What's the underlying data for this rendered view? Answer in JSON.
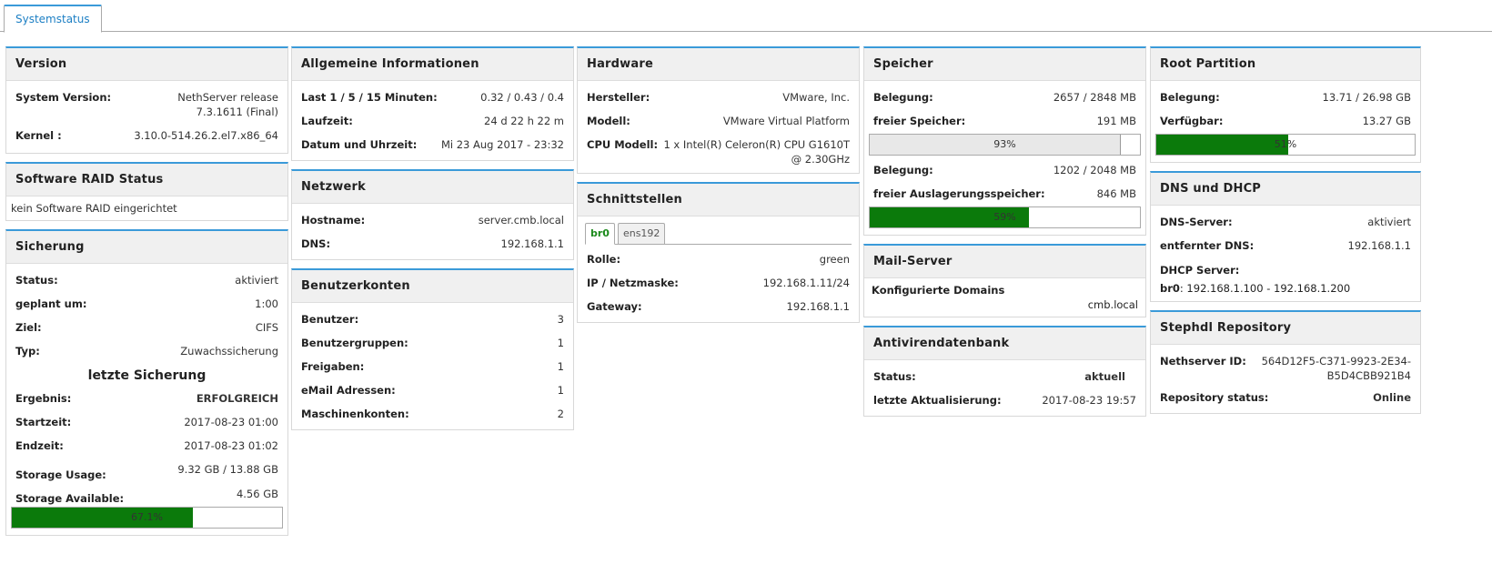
{
  "tab": {
    "label": "Systemstatus"
  },
  "version": {
    "title": "Version",
    "system_version_label": "System Version:",
    "system_version_value": "NethServer release 7.3.1611 (Final)",
    "kernel_label": "Kernel :",
    "kernel_value": "3.10.0-514.26.2.el7.x86_64"
  },
  "raid": {
    "title": "Software RAID Status",
    "text": "kein Software RAID eingerichtet"
  },
  "backup": {
    "title": "Sicherung",
    "status_label": "Status:",
    "status_value": "aktiviert",
    "planned_label": "geplant um:",
    "planned_value": "1:00",
    "target_label": "Ziel:",
    "target_value": "CIFS",
    "type_label": "Typ:",
    "type_value": "Zuwachssicherung",
    "last_title": "letzte Sicherung",
    "result_label": "Ergebnis:",
    "result_value": "ERFOLGREICH",
    "start_label": "Startzeit:",
    "start_value": "2017-08-23 01:00",
    "end_label": "Endzeit:",
    "end_value": "2017-08-23 01:02",
    "usage_label": "Storage Usage:",
    "usage_value": "9.32 GB / 13.88 GB",
    "avail_label": "Storage Available:",
    "avail_value": "4.56 GB",
    "progress_label": "67.1%",
    "progress": 0.671
  },
  "general": {
    "title": "Allgemeine Informationen",
    "load_label": "Last 1 / 5 / 15 Minuten:",
    "load_value": "0.32 / 0.43 / 0.4",
    "uptime_label": "Laufzeit:",
    "uptime_value": "24 d 22 h 22 m",
    "date_label": "Datum und Uhrzeit:",
    "date_value": "Mi 23 Aug 2017 - 23:32"
  },
  "network": {
    "title": "Netzwerk",
    "hostname_label": "Hostname:",
    "hostname_value": "server.cmb.local",
    "dns_label": "DNS:",
    "dns_value": "192.168.1.1"
  },
  "accounts": {
    "title": "Benutzerkonten",
    "users_label": "Benutzer:",
    "users_value": "3",
    "groups_label": "Benutzergruppen:",
    "groups_value": "1",
    "shares_label": "Freigaben:",
    "shares_value": "1",
    "email_label": "eMail Adressen:",
    "email_value": "1",
    "machines_label": "Maschinenkonten:",
    "machines_value": "2"
  },
  "hardware": {
    "title": "Hardware",
    "vendor_label": "Hersteller:",
    "vendor_value": "VMware, Inc.",
    "model_label": "Modell:",
    "model_value": "VMware Virtual Platform",
    "cpu_label": "CPU Modell:",
    "cpu_value": "1 x Intel(R) Celeron(R) CPU G1610T @ 2.30GHz"
  },
  "interfaces": {
    "title": "Schnittstellen",
    "tabs": [
      "br0",
      "ens192"
    ],
    "role_label": "Rolle:",
    "role_value": "green",
    "ip_label": "IP / Netzmaske:",
    "ip_value": "192.168.1.11/24",
    "gw_label": "Gateway:",
    "gw_value": "192.168.1.1"
  },
  "memory": {
    "title": "Speicher",
    "used_label": "Belegung:",
    "used_value": "2657 / 2848 MB",
    "free_label": "freier Speicher:",
    "free_value": "191 MB",
    "mem_progress_label": "93%",
    "mem_progress": 0.93,
    "swap_used_label": "Belegung:",
    "swap_used_value": "1202 / 2048 MB",
    "swap_free_label": "freier Auslagerungsspeicher:",
    "swap_free_value": "846 MB",
    "swap_progress_label": "59%",
    "swap_progress": 0.59
  },
  "mail": {
    "title": "Mail-Server",
    "domains_label": "Konfigurierte Domains",
    "domains_value": "cmb.local"
  },
  "antivirus": {
    "title": "Antivirendatenbank",
    "status_label": "Status:",
    "status_value": "aktuell",
    "updated_label": "letzte Aktualisierung:",
    "updated_value": "2017-08-23 19:57"
  },
  "root": {
    "title": "Root Partition",
    "used_label": "Belegung:",
    "used_value": "13.71 / 26.98 GB",
    "avail_label": "Verfügbar:",
    "avail_value": "13.27 GB",
    "progress_label": "51%",
    "progress": 0.51
  },
  "dns_dhcp": {
    "title": "DNS und DHCP",
    "dns_label": "DNS-Server:",
    "dns_value": "aktiviert",
    "remote_label": "entfernter DNS:",
    "remote_value": "192.168.1.1",
    "dhcp_label": "DHCP Server:",
    "range_iface": "br0",
    "range_value": ": 192.168.1.100 - 192.168.1.200"
  },
  "repo": {
    "title": "Stephdl Repository",
    "id_label": "Nethserver ID:",
    "id_value": "564D12F5-C371-9923-2E34-B5D4CBB921B4",
    "status_label": "Repository status:",
    "status_value": "Online"
  }
}
